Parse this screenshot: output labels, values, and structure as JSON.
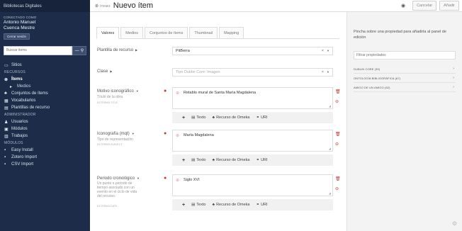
{
  "sidebar": {
    "site_title": "Bibliotecas Digitales",
    "connected_as_label": "CONECTADO COMO",
    "user_name_1": "Antonio Manuel",
    "user_name_2": "Cuenca Mestre",
    "logout_label": "Cerrar sesión",
    "search_placeholder": "Buscar items",
    "nav": [
      {
        "label": "Sitios",
        "icon": "sites-icon",
        "type": "item"
      },
      {
        "label": "RECURSOS",
        "type": "head"
      },
      {
        "label": "Ítems",
        "icon": "items-icon",
        "type": "active"
      },
      {
        "label": "Medios",
        "icon": "media-icon",
        "type": "sub"
      },
      {
        "label": "Conjuntos de ítems",
        "icon": "item-sets-icon",
        "type": "item"
      },
      {
        "label": "Vocabularios",
        "icon": "vocab-icon",
        "type": "item"
      },
      {
        "label": "Plantillas de recurso",
        "icon": "template-icon",
        "type": "item"
      },
      {
        "label": "ADMINISTRADOR",
        "type": "head"
      },
      {
        "label": "Usuarios",
        "icon": "user-icon",
        "type": "item"
      },
      {
        "label": "Módulos",
        "icon": "module-icon",
        "type": "item"
      },
      {
        "label": "Trabajos",
        "icon": "jobs-icon",
        "type": "item"
      },
      {
        "label": "MÓDULOS",
        "type": "head"
      },
      {
        "label": "Easy Install",
        "icon": "install-icon",
        "type": "item"
      },
      {
        "label": "Zotero Import",
        "icon": "zotero-icon",
        "type": "item"
      },
      {
        "label": "CSV Import",
        "icon": "csv-icon",
        "type": "item"
      }
    ]
  },
  "header": {
    "section_label": "ÍTEMS",
    "title": "Nuevo ítem",
    "cancel_label": "Cancelar",
    "add_label": "Añadir"
  },
  "tabs": [
    "Valores",
    "Medios",
    "Conjuntos de ítems",
    "Thumbnail",
    "Mapping"
  ],
  "form": {
    "template_label": "Plantilla de recurso",
    "template_value": "PitBerra",
    "class_label": "Clase",
    "class_placeholder": "Tipo Dublin Core: Imagen",
    "fields": [
      {
        "label": "Motivo iconográfico",
        "desc": "Título de la obra",
        "term": "DCTERMS:TITLE",
        "value": "Retablo mural de Santa María Magdalena"
      },
      {
        "label": "Iconografía (mqt)",
        "desc": "Tipo de representación",
        "term": "DCTERMS:SUBJECT",
        "value": "María Magdalena"
      },
      {
        "label": "Periodo cronológico",
        "desc": "Un punto o periodo de tiempo asociado con un evento en el ciclo de vida del recurso.",
        "term": "DCTERMS:DATE",
        "value": "Siglo XVI"
      }
    ],
    "add_text_label": "Texto",
    "add_omeka_label": "Recurso de Omeka",
    "add_uri_label": "URI"
  },
  "right_panel": {
    "help_text": "Pincha sobre una propiedad para añadirla al panel de edición",
    "filter_placeholder": "Filtrar propiedades",
    "vocabularies": [
      "DUBLIN CORE (39)",
      "ONTOLOGÍA BIBLIOGRÁFICA (67)",
      "AMIGO DE UN AMIGO (62)"
    ]
  }
}
